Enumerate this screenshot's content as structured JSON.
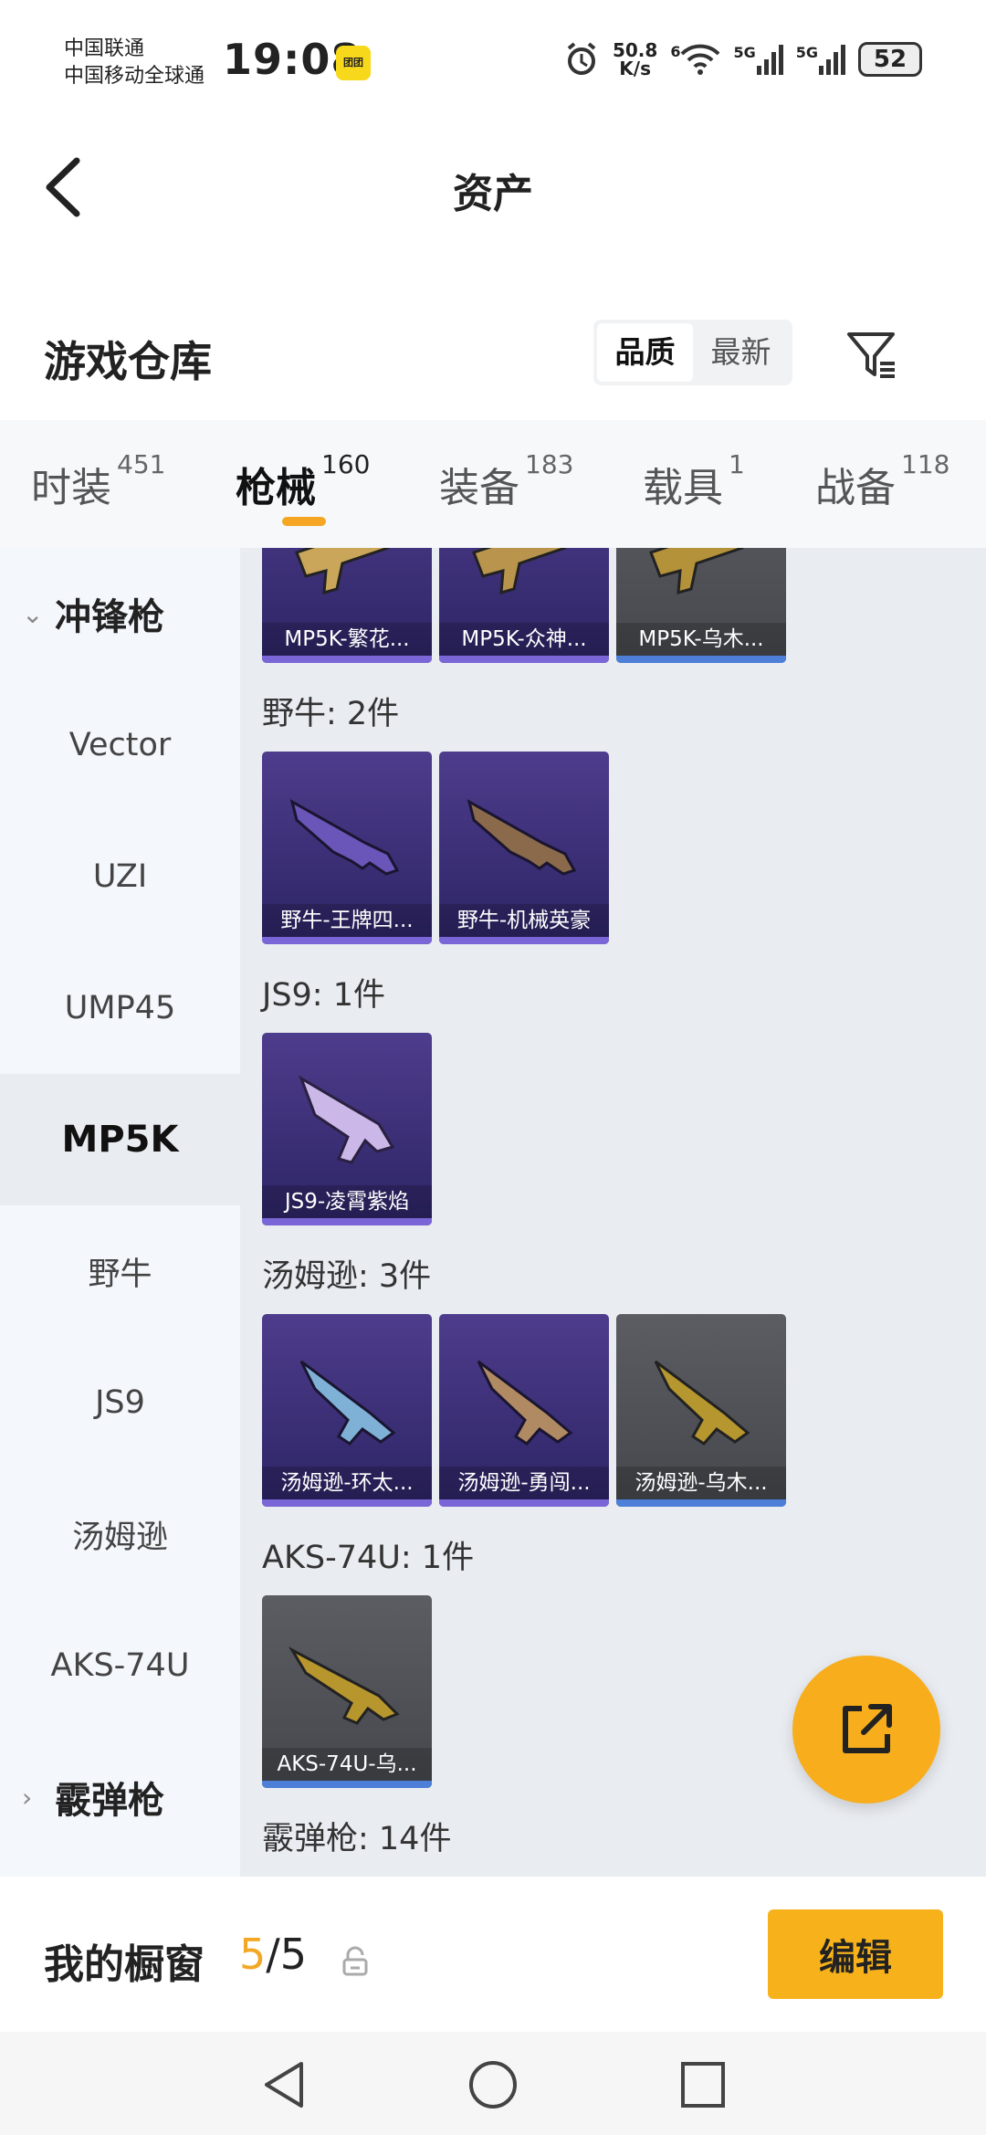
{
  "status": {
    "carrier1": "中国联通",
    "carrier2": "中国移动全球通",
    "time": "19:08",
    "app_badge": "团团",
    "net_speed_value": "50.8",
    "net_speed_unit": "K/s",
    "wifi_gen": "6",
    "sig1": "5G",
    "sig2": "5G",
    "battery": "52"
  },
  "header": {
    "title": "资产",
    "back_icon": "back-arrow-icon"
  },
  "warehouse": {
    "title": "游戏仓库",
    "sort_quality": "品质",
    "sort_newest": "最新",
    "sort_selected": "品质",
    "filter_icon": "filter-icon"
  },
  "tabs": [
    {
      "label": "时装",
      "count": "451"
    },
    {
      "label": "枪械",
      "count": "160",
      "active": true
    },
    {
      "label": "装备",
      "count": "183"
    },
    {
      "label": "载具",
      "count": "1"
    },
    {
      "label": "战备",
      "count": "118"
    }
  ],
  "side_menu": {
    "group1": "冲锋枪",
    "items": [
      "Vector",
      "UZI",
      "UMP45",
      "MP5K",
      "野牛",
      "JS9",
      "汤姆逊",
      "AKS-74U"
    ],
    "selected": "MP5K",
    "group2": "霰弹枪"
  },
  "sections": [
    {
      "title": "",
      "items": [
        {
          "name": "MP5K-繁花...",
          "rarity": "purple"
        },
        {
          "name": "MP5K-众神...",
          "rarity": "purple"
        },
        {
          "name": "MP5K-乌木...",
          "rarity": "gray"
        }
      ]
    },
    {
      "title": "野牛: 2件",
      "items": [
        {
          "name": "野牛-王牌四...",
          "rarity": "purple"
        },
        {
          "name": "野牛-机械英豪",
          "rarity": "purple"
        }
      ]
    },
    {
      "title": "JS9: 1件",
      "items": [
        {
          "name": "JS9-凌霄紫焰",
          "rarity": "purple"
        }
      ]
    },
    {
      "title": "汤姆逊: 3件",
      "items": [
        {
          "name": "汤姆逊-环太...",
          "rarity": "purple"
        },
        {
          "name": "汤姆逊-勇闯...",
          "rarity": "purple"
        },
        {
          "name": "汤姆逊-乌木...",
          "rarity": "gray"
        }
      ]
    },
    {
      "title": "AKS-74U: 1件",
      "items": [
        {
          "name": "AKS-74U-乌...",
          "rarity": "gray"
        }
      ]
    },
    {
      "title": "霰弹枪: 14件",
      "items": []
    }
  ],
  "fab_icon": "share-external-icon",
  "showcase": {
    "title": "我的橱窗",
    "current": "5",
    "separator": "/",
    "total": "5",
    "edit_label": "编辑"
  },
  "colors": {
    "accent": "#f7b21b",
    "purple_card": "#3b2f78",
    "gray_card": "#55575c",
    "blue_bar": "#4d7fd9"
  }
}
